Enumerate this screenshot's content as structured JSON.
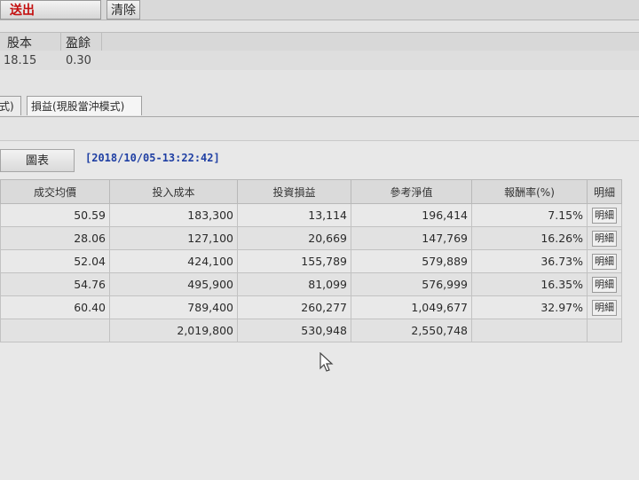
{
  "toolbar": {
    "send_label": "送出",
    "clear_label": "清除"
  },
  "info": {
    "headers": [
      "股本",
      "盈餘"
    ],
    "values": [
      "18.15",
      "0.30"
    ]
  },
  "tabs": [
    {
      "label": "式)"
    },
    {
      "label": "損益(現股當沖模式)"
    }
  ],
  "panel": {
    "chart_button": "圖表",
    "timestamp": "[2018/10/05-13:22:42]"
  },
  "table": {
    "columns": [
      "成交均價",
      "投入成本",
      "投資損益",
      "參考淨值",
      "報酬率(%)",
      "明細"
    ],
    "rows": [
      [
        "50.59",
        "183,300",
        "13,114",
        "196,414",
        "7.15%",
        "明細"
      ],
      [
        "28.06",
        "127,100",
        "20,669",
        "147,769",
        "16.26%",
        "明細"
      ],
      [
        "52.04",
        "424,100",
        "155,789",
        "579,889",
        "36.73%",
        "明細"
      ],
      [
        "54.76",
        "495,900",
        "81,099",
        "576,999",
        "16.35%",
        "明細"
      ],
      [
        "60.40",
        "789,400",
        "260,277",
        "1,049,677",
        "32.97%",
        "明細"
      ]
    ],
    "totals": [
      "",
      "2,019,800",
      "530,948",
      "2,550,748",
      "",
      ""
    ]
  },
  "icons": {
    "cursor": "mouse-pointer-icon"
  },
  "colors": {
    "send": "#c41010",
    "timestamp": "#1f3fa3"
  }
}
